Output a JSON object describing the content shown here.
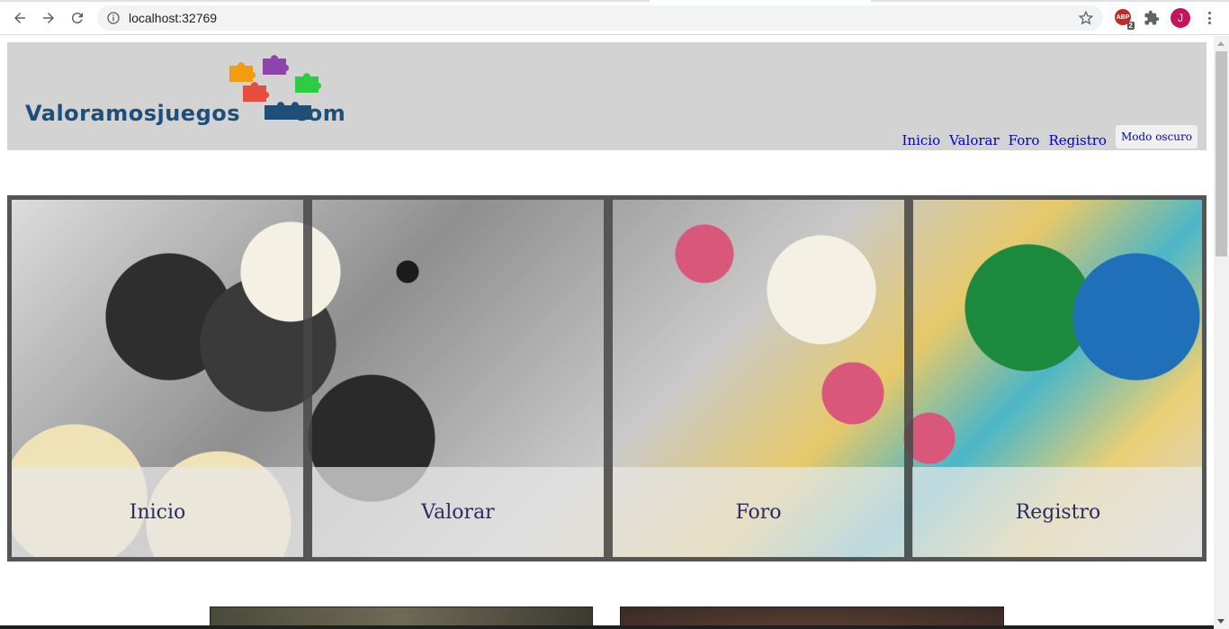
{
  "browser": {
    "url": "localhost:32769",
    "abp_label": "ABP",
    "abp_badge": "2",
    "profile_initial": "J",
    "icons": [
      "back-icon",
      "forward-icon",
      "reload-icon",
      "info-icon",
      "star-icon",
      "puzzle-icon",
      "menu-icon"
    ]
  },
  "site": {
    "logo": {
      "main": "Valoramosjuegos",
      "suffix": "com"
    },
    "nav": [
      {
        "label": "Inicio"
      },
      {
        "label": "Valorar"
      },
      {
        "label": "Foro"
      },
      {
        "label": "Registro"
      }
    ],
    "dark_mode_label": "Modo oscuro",
    "hero": {
      "cards": [
        {
          "label": "Inicio"
        },
        {
          "label": "Valorar"
        },
        {
          "label": "Foro"
        },
        {
          "label": "Registro"
        }
      ]
    },
    "colors": {
      "header_bg": "#d3d3d3",
      "link": "#0000cc",
      "card_text": "#2b2b66",
      "logo_text": "#1f4e79"
    }
  }
}
